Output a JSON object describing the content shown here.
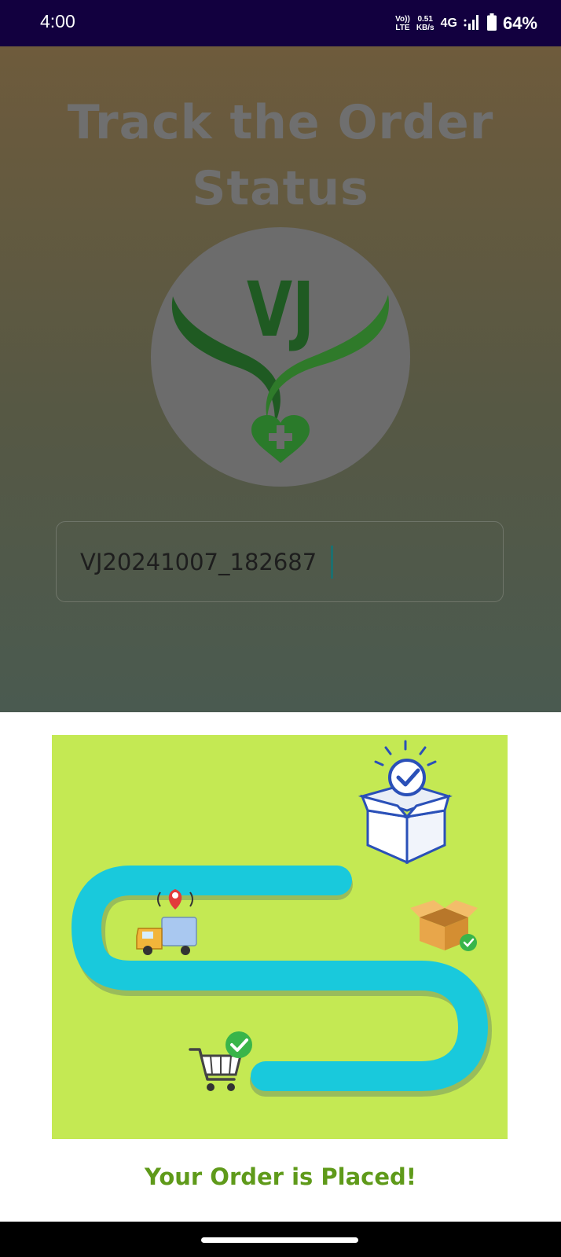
{
  "status_bar": {
    "time": "4:00",
    "volte_top": "Vo))",
    "volte_bottom": "LTE",
    "speed_value": "0.51",
    "speed_unit": "KB/s",
    "network": "4G",
    "battery": "64%",
    "icons": [
      "signal-icon",
      "battery-icon"
    ]
  },
  "header": {
    "title": "Track the Order Status"
  },
  "logo": {
    "text": "VJ",
    "icon": "heart-plus-icon",
    "colors": {
      "circle": "#6c6c6c",
      "dark_green": "#1f5a22",
      "light_green": "#2e7a2a"
    }
  },
  "tracking_input": {
    "value": "VJ20241007_182687"
  },
  "illustration": {
    "background": "#c4e953",
    "road_color": "#19c9dc",
    "icons": [
      "box-check-icon",
      "truck-location-icon",
      "open-box-icon",
      "cart-check-icon"
    ]
  },
  "message": {
    "text": "Your Order is Placed!",
    "color": "#5f9a1a"
  }
}
